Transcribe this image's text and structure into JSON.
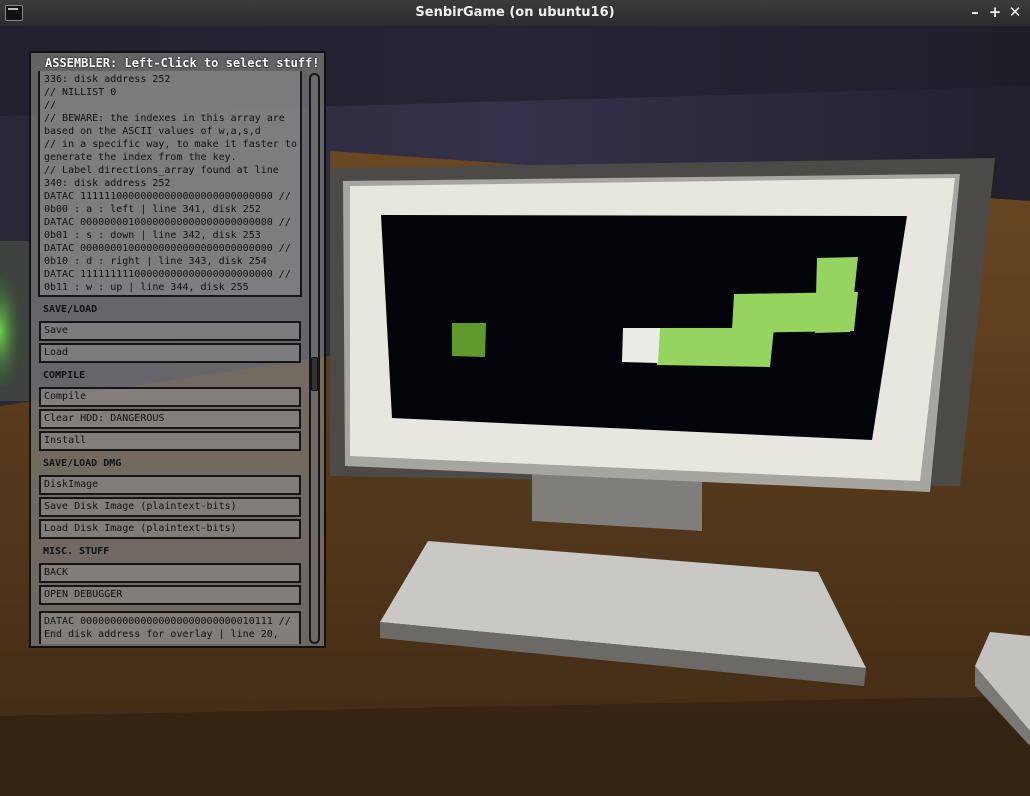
{
  "window": {
    "title": "SenbirGame (on ubuntu16)",
    "controls": {
      "minimize": "–",
      "maximize": "+",
      "close": "✕"
    }
  },
  "panel": {
    "header": "ASSEMBLER: Left-Click to select stuff!",
    "code_lines": [
      "336: disk address 252",
      "// NILLIST 0",
      "//",
      "// BEWARE: the indexes in this array are",
      "based on the ASCII values of w,a,s,d",
      "// in a specific way, to make it faster to",
      "generate the index from the key.",
      "// Label directions_array found at line",
      "340: disk address 252",
      "DATAC 11111100000000000000000000000000 //",
      "0b00 : a : left | line 341, disk 252",
      "DATAC 00000000100000000000000000000000 //",
      "0b01 : s : down | line 342, disk 253",
      "DATAC 00000001000000000000000000000000 //",
      "0b10 : d : right | line 343, disk 254",
      "DATAC 11111111100000000000000000000000 //",
      "0b11 : w : up | line 344, disk 255"
    ],
    "sections": {
      "save_load": "SAVE/LOAD",
      "compile": "COMPILE",
      "save_load_dmg": "SAVE/LOAD DMG",
      "misc": "MISC. STUFF"
    },
    "buttons": {
      "save": "Save",
      "load": "Load",
      "compile": "Compile",
      "clear_hdd": "Clear HDD: DANGEROUS",
      "install": "Install",
      "disk_image": "DiskImage",
      "save_disk_image": "Save Disk Image (plaintext-bits)",
      "load_disk_image": "Load Disk Image (plaintext-bits)",
      "back": "BACK",
      "open_debugger": "OPEN DEBUGGER"
    },
    "bottom_lines": [
      "DATAC 00000000000000000000000000010111 //",
      "End disk address for overlay | line 20,"
    ]
  },
  "colors": {
    "snake": "#95d45e",
    "snake_head": "#ecece6",
    "food": "#5f9a2a",
    "monitor_screen": "#03030a",
    "desk": "#5c3d1f"
  }
}
